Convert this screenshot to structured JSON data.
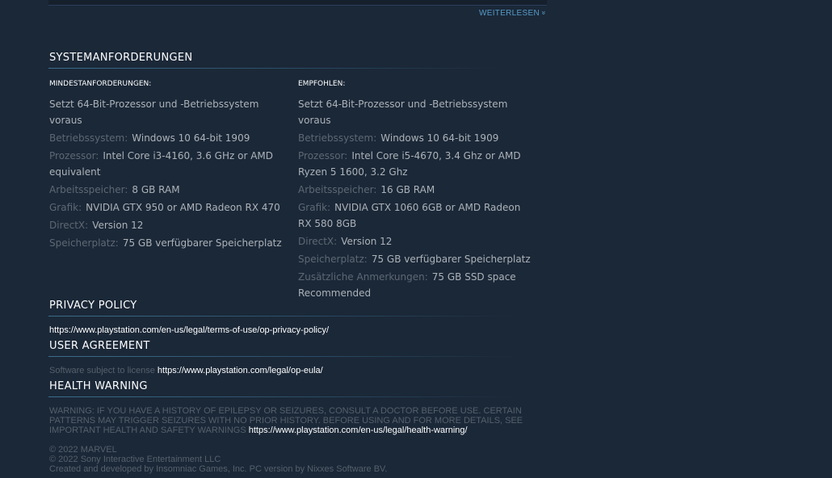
{
  "read_more": {
    "label": "WEITERLESEN",
    "icon": "double-chevron-down-icon"
  },
  "system_requirements": {
    "title": "SYSTEMANFORDERUNGEN",
    "minimum": {
      "heading": "MINDESTANFORDERUNGEN:",
      "note": "Setzt 64-Bit-Prozessor und -Betriebssystem voraus",
      "items": [
        {
          "label": "Betriebssystem:",
          "value": "Windows 10 64-bit 1909"
        },
        {
          "label": "Prozessor:",
          "value": "Intel Core i3-4160, 3.6 GHz or AMD equivalent"
        },
        {
          "label": "Arbeitsspeicher:",
          "value": "8 GB RAM"
        },
        {
          "label": "Grafik:",
          "value": "NVIDIA GTX 950 or AMD Radeon RX 470"
        },
        {
          "label": "DirectX:",
          "value": "Version 12"
        },
        {
          "label": "Speicherplatz:",
          "value": "75 GB verfügbarer Speicherplatz"
        }
      ]
    },
    "recommended": {
      "heading": "EMPFOHLEN:",
      "note": "Setzt 64-Bit-Prozessor und -Betriebssystem voraus",
      "items": [
        {
          "label": "Betriebssystem:",
          "value": "Windows 10 64-bit 1909"
        },
        {
          "label": "Prozessor:",
          "value": "Intel Core i5-4670, 3.4 Ghz or AMD Ryzen 5 1600, 3.2 Ghz"
        },
        {
          "label": "Arbeitsspeicher:",
          "value": "16 GB RAM"
        },
        {
          "label": "Grafik:",
          "value": "NVIDIA GTX 1060 6GB or AMD Radeon RX 580 8GB"
        },
        {
          "label": "DirectX:",
          "value": "Version 12"
        },
        {
          "label": "Speicherplatz:",
          "value": "75 GB verfügbarer Speicherplatz"
        },
        {
          "label": "Zusätzliche Anmerkungen:",
          "value": "75 GB SSD space Recommended"
        }
      ]
    }
  },
  "privacy_policy": {
    "title": "PRIVACY POLICY",
    "link": "https://www.playstation.com/en-us/legal/terms-of-use/op-privacy-policy/"
  },
  "user_agreement": {
    "title": "USER AGREEMENT",
    "prefix": "Software subject to license ",
    "link": "https://www.playstation.com/legal/op-eula/"
  },
  "health_warning": {
    "title": "HEALTH WARNING",
    "lines": [
      "WARNING: IF YOU HAVE A HISTORY OF EPILEPSY OR SEIZURES, CONSULT A DOCTOR BEFORE USE. CERTAIN",
      "PATTERNS MAY TRIGGER SEIZURES WITH NO PRIOR HISTORY. BEFORE USING AND FOR MORE DETAILS, SEE",
      "IMPORTANT HEALTH AND SAFETY WARNINGS "
    ],
    "link": "https://www.playstation.com/en-us/legal/health-warning/"
  },
  "copyright": {
    "lines": [
      "© 2022 MARVEL",
      "© 2022 Sony Interactive Entertainment LLC",
      "Created and developed by Insomniac Games, Inc. PC version by Nixxes Software BV."
    ]
  }
}
